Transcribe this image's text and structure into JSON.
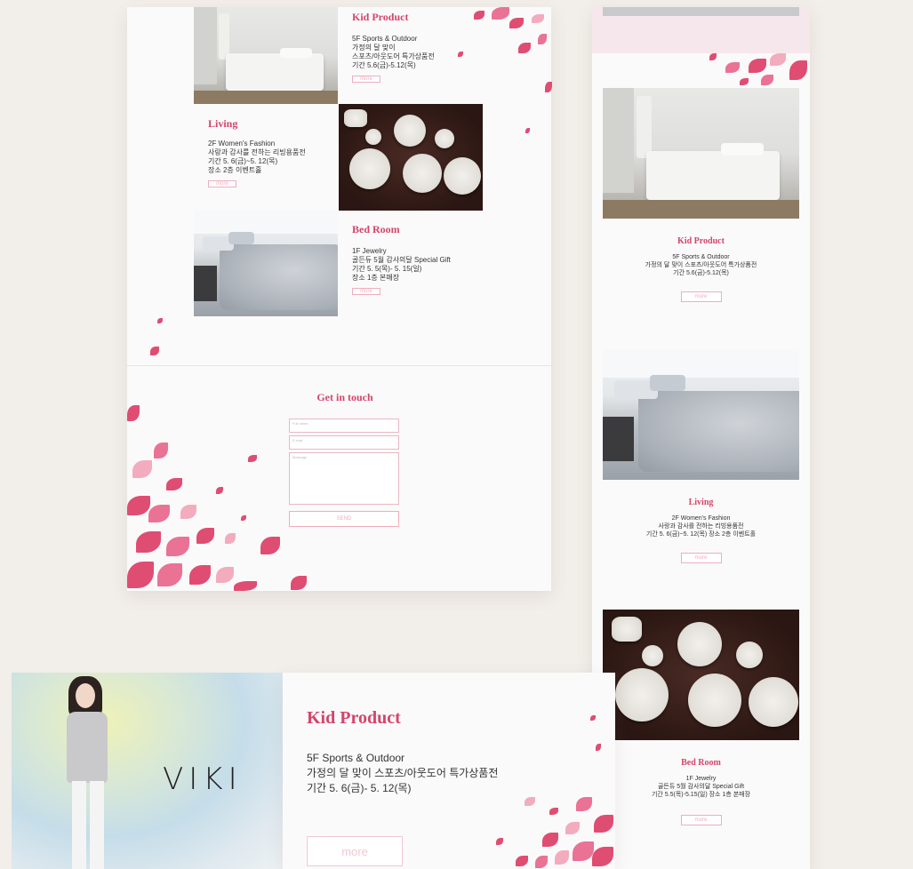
{
  "left_page": {
    "sections": [
      {
        "title": "Kid Product",
        "lines": [
          "5F Sports & Outdoor",
          "가정의 달 맞이",
          "스포츠/아웃도어 특가상품전",
          "기간 5.6(금)-5.12(목)"
        ],
        "button": "more"
      },
      {
        "title": "Living",
        "lines": [
          "2F Women's Fashion",
          "사랑과 감사를 전하는 리빙용품전",
          "기간 5. 6(금)~5. 12(목)",
          "장소 2층 이벤트홀"
        ],
        "button": "more"
      },
      {
        "title": "Bed Room",
        "lines": [
          "1F Jewelry",
          "골든듀 5월 감사의달 Special Gift",
          "기간 5. 5(목)- 5. 15(일)",
          "장소 1층 본매장"
        ],
        "button": "more"
      }
    ],
    "contact": {
      "title": "Get in touch",
      "name_placeholder": "Full name",
      "email_placeholder": "E-mail",
      "message_placeholder": "Message",
      "send_label": "SEND"
    }
  },
  "right_page": {
    "sections": [
      {
        "title": "Kid Product",
        "lines": [
          "5F Sports & Outdoor",
          "가정의 달 맞이 스포츠/아웃도어 특가상품전",
          "기간 5.6(금)-5.12(목)"
        ],
        "button": "more"
      },
      {
        "title": "Living",
        "lines": [
          "2F Women's Fashion",
          "사랑과 감사를 전하는 리빙용품전",
          "기간 5. 6(금)~5. 12(목)  장소 2층 이벤트홀"
        ],
        "button": "more"
      },
      {
        "title": "Bed Room",
        "lines": [
          "1F Jewelry",
          "골든듀 5월 감사의달 Special Gift",
          "기간 5.5(목)-5.15(일) 장소 1층 본매장"
        ],
        "button": "more"
      }
    ]
  },
  "banner": {
    "brand": "VIKI",
    "title": "Kid Product",
    "lines": [
      "5F Sports & Outdoor",
      "가정의 달 맞이 스포츠/아웃도어 특가상품전",
      "기간 5. 6(금)- 5. 12(목)"
    ],
    "button": "more"
  },
  "colors": {
    "accent": "#d4456a",
    "panel": "#fbfafb",
    "background": "#f2eee9"
  }
}
